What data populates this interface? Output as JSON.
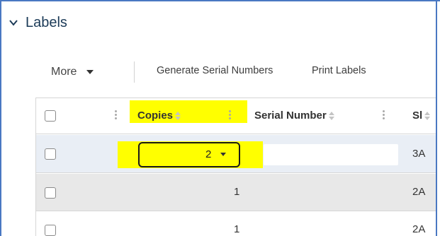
{
  "section": {
    "title": "Labels"
  },
  "toolbar": {
    "more_label": "More",
    "generate_label": "Generate Serial Numbers",
    "print_label": "Print Labels"
  },
  "table": {
    "columns": [
      "Copies",
      "Serial Number",
      "Sl"
    ],
    "rows": [
      {
        "copies": "2",
        "serial": "",
        "sl": "3A"
      },
      {
        "copies": "1",
        "serial": "",
        "sl": "2A"
      },
      {
        "copies": "1",
        "serial": "",
        "sl": "2A"
      }
    ]
  },
  "colors": {
    "highlight": "#ffff00",
    "frame": "#4a78c2",
    "selected_row": "#e9eef5"
  }
}
